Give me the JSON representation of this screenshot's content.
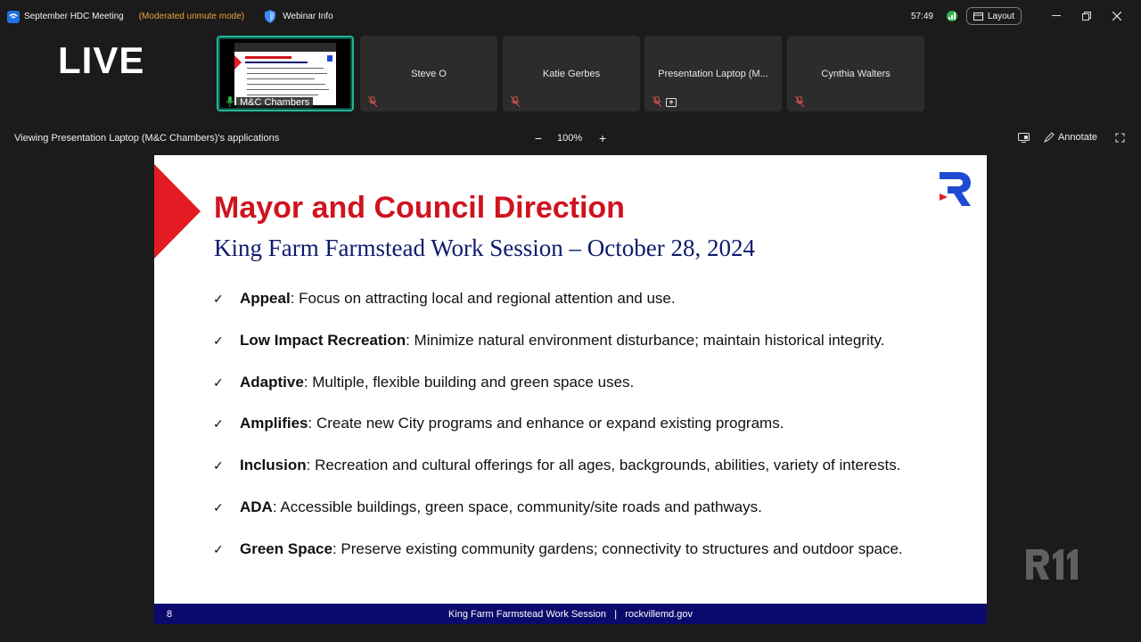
{
  "titlebar": {
    "meeting_title": "September HDC Meeting",
    "mode": "(Moderated unmute mode)",
    "webinar_info": "Webinar Info",
    "timer": "57:49",
    "layout_label": "Layout"
  },
  "live_label": "LIVE",
  "participants": [
    {
      "name": "M&C Chambers"
    },
    {
      "name": "Steve O"
    },
    {
      "name": "Katie Gerbes"
    },
    {
      "name": "Presentation Laptop (M..."
    },
    {
      "name": "Cynthia Walters"
    }
  ],
  "share_bar": {
    "viewing_text": "Viewing Presentation Laptop (M&C Chambers)'s applications",
    "zoom_minus": "−",
    "zoom_level": "100%",
    "zoom_plus": "+",
    "annotate_label": "Annotate"
  },
  "slide": {
    "title": "Mayor and Council Direction",
    "subtitle": "King Farm Farmstead Work Session – October 28, 2024",
    "check": "✓",
    "bullets": [
      {
        "term": "Appeal",
        "text": ": Focus on attracting local and regional attention and use."
      },
      {
        "term": "Low Impact Recreation",
        "text": ": Minimize natural environment disturbance; maintain historical integrity."
      },
      {
        "term": "Adaptive",
        "text": ": Multiple, flexible building and green space uses."
      },
      {
        "term": "Amplifies",
        "text": ": Create new City programs and enhance or expand existing programs."
      },
      {
        "term": "Inclusion",
        "text": ": Recreation and cultural offerings for all ages, backgrounds, abilities, variety of interests."
      },
      {
        "term": "ADA",
        "text": ": Accessible buildings, green space, community/site roads and pathways."
      },
      {
        "term": "Green Space",
        "text": ": Preserve existing community gardens; connectivity to structures and outdoor space."
      }
    ],
    "page_number": "8",
    "footer_text": "King Farm Farmstead Work Session   |   rockvillemd.gov"
  },
  "colors": {
    "accent_red": "#e31b23",
    "title_red": "#d0131f",
    "subtitle_navy": "#0d1a6e",
    "footer_navy": "#0b0a6c",
    "active_speaker": "#1fb79a",
    "mode_orange": "#e8a33c"
  },
  "icons": [
    "zoom-logo-icon",
    "shield-icon",
    "signal-icon",
    "layout-icon",
    "minimize-icon",
    "restore-icon",
    "close-icon",
    "mic-muted-icon",
    "share-screen-icon",
    "view-options-icon",
    "annotate-icon",
    "fullscreen-icon",
    "rockville-logo-icon",
    "r11-watermark-icon"
  ]
}
